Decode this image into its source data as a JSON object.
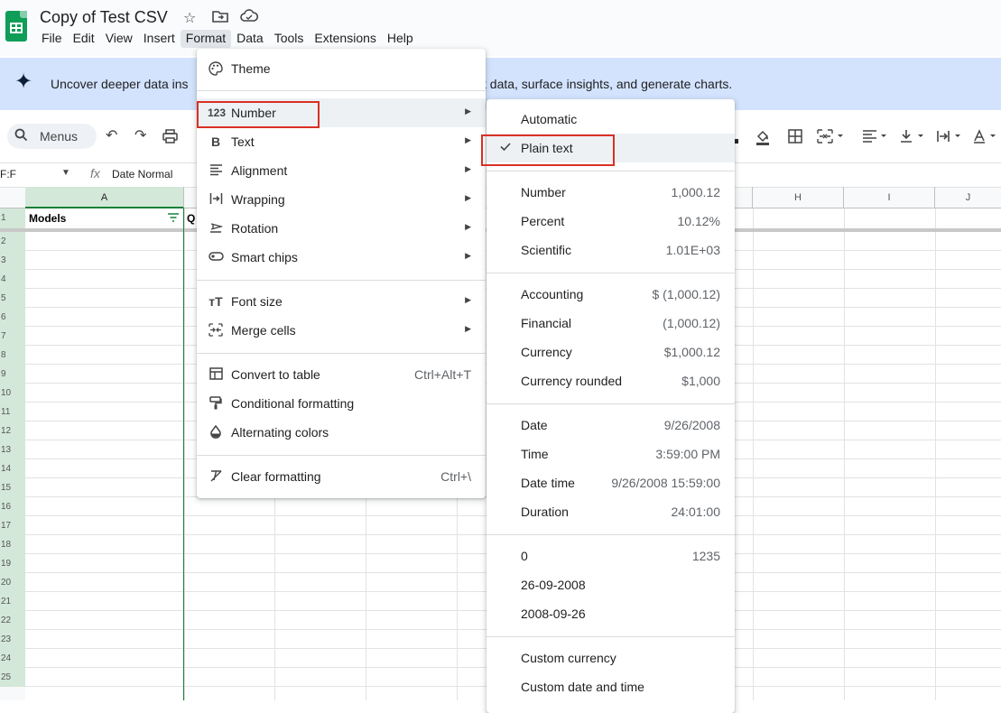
{
  "app": {
    "doc_title": "Copy of Test CSV",
    "menu": [
      "File",
      "Edit",
      "View",
      "Insert",
      "Format",
      "Data",
      "Tools",
      "Extensions",
      "Help"
    ]
  },
  "banner": {
    "text_left": "Uncover deeper data ins",
    "text_right": "t data, surface insights, and generate charts."
  },
  "toolbar": {
    "search_label": "Menus"
  },
  "formula_bar": {
    "name_box": "F:F",
    "value": "Date Normal"
  },
  "sheet": {
    "columns": [
      "A",
      "H",
      "I",
      "J"
    ],
    "rows": [
      "1",
      "2",
      "3",
      "4",
      "5",
      "6",
      "7",
      "8",
      "9",
      "10",
      "11",
      "12",
      "13",
      "14",
      "15",
      "16",
      "17",
      "18",
      "19",
      "20",
      "21",
      "22",
      "23",
      "24",
      "25"
    ],
    "a1": "Models",
    "b1_partial": "Q"
  },
  "format_menu": {
    "items": [
      {
        "label": "Theme",
        "icon": "palette-icon"
      },
      {
        "label": "Number",
        "icon": "number-123-icon",
        "submenu": true
      },
      {
        "label": "Text",
        "icon": "bold-icon",
        "submenu": true
      },
      {
        "label": "Alignment",
        "icon": "align-icon",
        "submenu": true
      },
      {
        "label": "Wrapping",
        "icon": "wrap-icon",
        "submenu": true
      },
      {
        "label": "Rotation",
        "icon": "rotation-icon",
        "submenu": true
      },
      {
        "label": "Smart chips",
        "icon": "smart-chip-icon",
        "submenu": true
      },
      {
        "label": "Font size",
        "icon": "font-size-icon",
        "submenu": true
      },
      {
        "label": "Merge cells",
        "icon": "merge-icon",
        "submenu": true
      },
      {
        "label": "Convert to table",
        "icon": "table-icon",
        "shortcut": "Ctrl+Alt+T"
      },
      {
        "label": "Conditional formatting",
        "icon": "paint-roller-icon"
      },
      {
        "label": "Alternating colors",
        "icon": "color-drop-icon"
      },
      {
        "label": "Clear formatting",
        "icon": "clear-format-icon",
        "shortcut": "Ctrl+\\"
      }
    ]
  },
  "number_menu": {
    "items": [
      {
        "label": "Automatic",
        "value": ""
      },
      {
        "label": "Plain text",
        "value": "",
        "checked": true
      },
      {
        "label": "Number",
        "value": "1,000.12"
      },
      {
        "label": "Percent",
        "value": "10.12%"
      },
      {
        "label": "Scientific",
        "value": "1.01E+03"
      },
      {
        "label": "Accounting",
        "value": "$ (1,000.12)"
      },
      {
        "label": "Financial",
        "value": "(1,000.12)"
      },
      {
        "label": "Currency",
        "value": "$1,000.12"
      },
      {
        "label": "Currency rounded",
        "value": "$1,000"
      },
      {
        "label": "Date",
        "value": "9/26/2008"
      },
      {
        "label": "Time",
        "value": "3:59:00 PM"
      },
      {
        "label": "Date time",
        "value": "9/26/2008 15:59:00"
      },
      {
        "label": "Duration",
        "value": "24:01:00"
      },
      {
        "label": "0",
        "value": "1235"
      },
      {
        "label": "26-09-2008",
        "value": ""
      },
      {
        "label": "2008-09-26",
        "value": ""
      },
      {
        "label": "Custom currency",
        "value": ""
      },
      {
        "label": "Custom date and time",
        "value": ""
      }
    ]
  },
  "colors": {
    "accent_green": "#188038",
    "highlight_red": "#d93025",
    "banner_bg": "#d3e3fd"
  }
}
